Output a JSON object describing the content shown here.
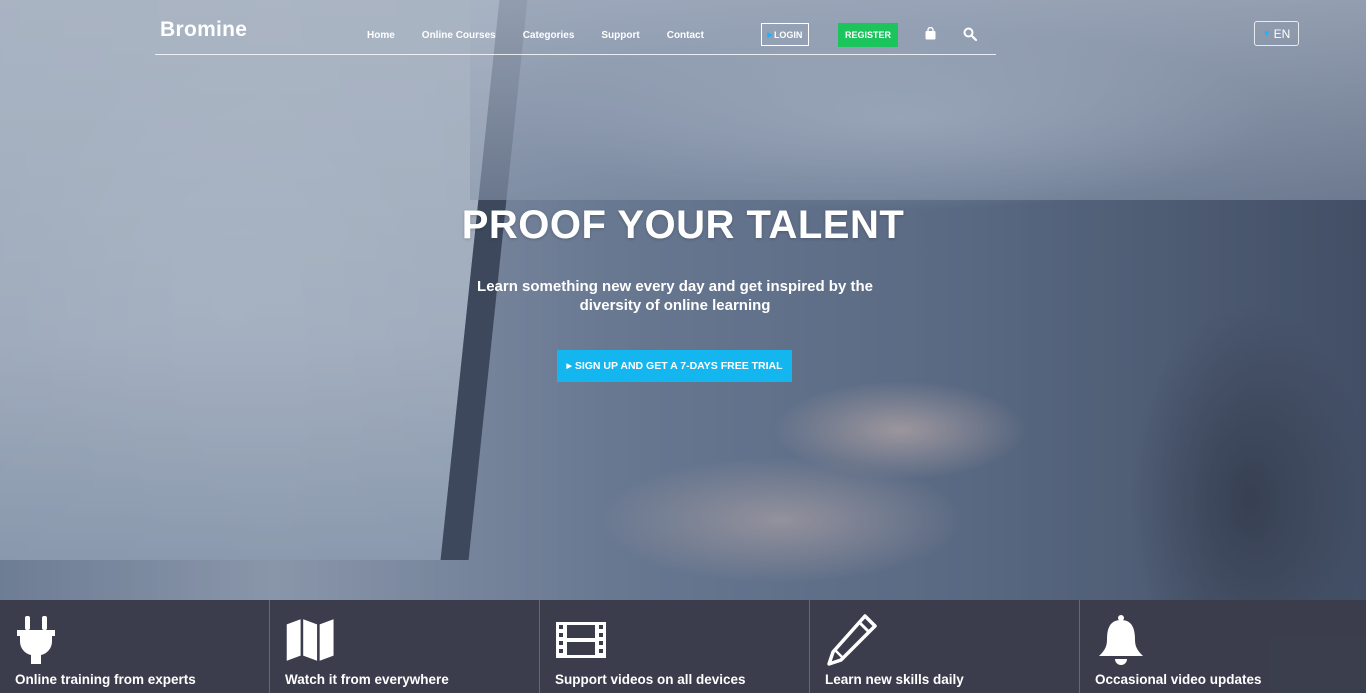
{
  "brand": "Bromine",
  "nav": {
    "links": [
      "Home",
      "Online Courses",
      "Categories",
      "Support",
      "Contact"
    ],
    "login_label": "LOGIN",
    "register_label": "REGISTER"
  },
  "language": {
    "selected": "EN"
  },
  "hero": {
    "title": "PROOF YOUR TALENT",
    "subtitle": "Learn something new every day and get inspired by the diversity of online learning",
    "cta_label": "SIGN UP AND GET A 7-DAYS FREE TRIAL"
  },
  "features": [
    {
      "icon": "plug-icon",
      "label": "Online training from experts"
    },
    {
      "icon": "map-icon",
      "label": "Watch it from everywhere"
    },
    {
      "icon": "film-icon",
      "label": "Support videos on all devices"
    },
    {
      "icon": "pencil-icon",
      "label": "Learn new skills daily"
    },
    {
      "icon": "bell-icon",
      "label": "Occasional video updates"
    }
  ],
  "colors": {
    "register_green": "#1bc45c",
    "cta_blue": "#14b6f0",
    "accent_caret": "#1cb3ff",
    "features_bg": "#3a3c4a"
  }
}
